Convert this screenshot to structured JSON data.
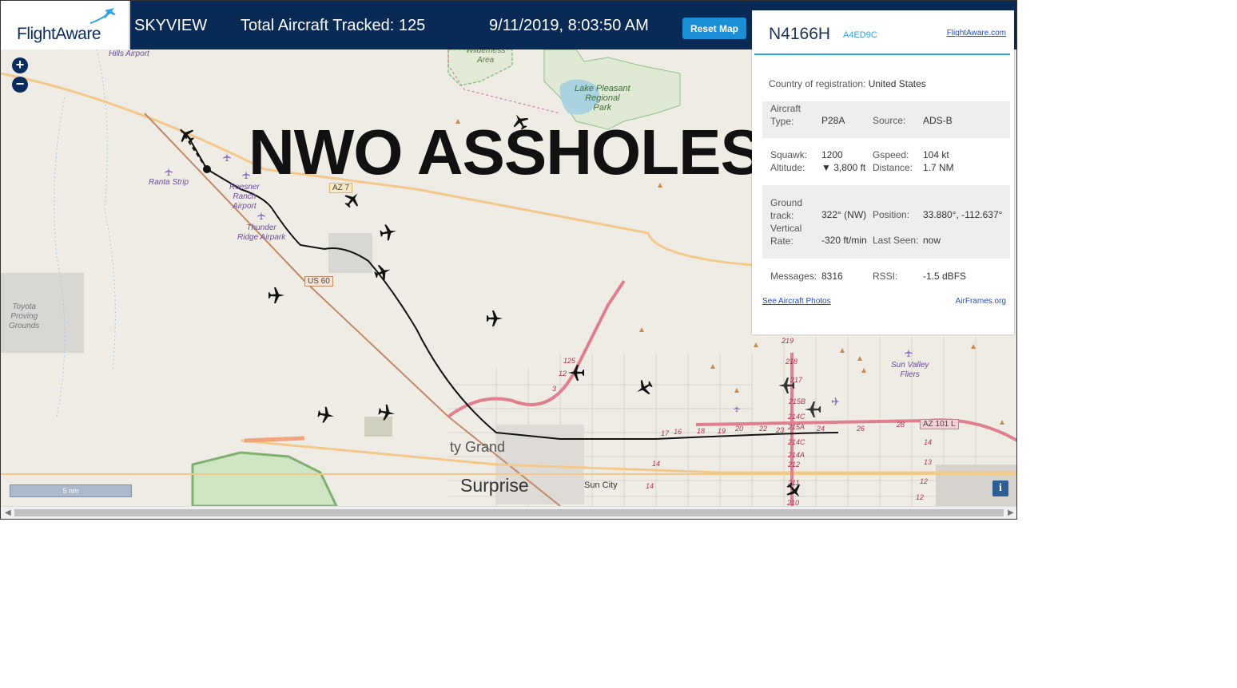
{
  "header": {
    "brand": "FlightAware",
    "view": "SKYVIEW",
    "tracked_label": "Total Aircraft Tracked: 125",
    "datetime": "9/11/2019, 8:03:50 AM",
    "reset_label": "Reset Map"
  },
  "overlay_text": "NWO ASSHOLES",
  "map": {
    "zoom_in": "+",
    "zoom_out": "−",
    "scale_label": "5 nm",
    "info_label": "i",
    "labels": {
      "hills_airport": "Hills Airport",
      "wilderness": "Wilderness\nArea",
      "lake_pleasant": "Lake Pleasant\nRegional\nPark",
      "ranta_strip": "Ranta Strip",
      "roesner": "Roesner\nRanch\nAirport",
      "thunder_ridge": "Thunder\nRidge Airpark",
      "toyota": "Toyota\nProving\nGrounds",
      "sun_valley": "Sun Valley\nFliers",
      "surprise": "Surprise",
      "sun_city": "Sun City",
      "city_grand": "ty Grand",
      "us60": "US 60",
      "az74": "AZ 7",
      "az101": "AZ 101 L"
    },
    "exits": [
      "219",
      "218",
      "217",
      "215B",
      "214C",
      "215A",
      "214C",
      "214A",
      "212",
      "211",
      "210",
      "125",
      "12",
      "3",
      "17",
      "16",
      "18",
      "19",
      "20",
      "22",
      "23",
      "24",
      "26",
      "28",
      "14",
      "13",
      "12",
      "14",
      "12",
      "14"
    ]
  },
  "panel": {
    "callsign": "N4166H",
    "hex": "A4ED9C",
    "link": "FlightAware.com",
    "country_label": "Country of registration:",
    "country_value": "United States",
    "aircraft_type_label": "Aircraft\nType:",
    "aircraft_type_value": "P28A",
    "source_label": "Source:",
    "source_value": "ADS-B",
    "squawk_label": "Squawk:",
    "squawk_value": "1200",
    "altitude_label": "Altitude:",
    "altitude_value": "▼ 3,800 ft",
    "gspeed_label": "Gspeed:",
    "gspeed_value": "104 kt",
    "distance_label": "Distance:",
    "distance_value": "1.7 NM",
    "ground_track_label": "Ground\ntrack:",
    "ground_track_value": "322° (NW)",
    "position_label": "Position:",
    "position_value": "33.880°, -112.637°",
    "vertical_rate_label": "Vertical\nRate:",
    "vertical_rate_value": "-320 ft/min",
    "last_seen_label": "Last Seen:",
    "last_seen_value": "now",
    "messages_label": "Messages:",
    "messages_value": "8316",
    "rssi_label": "RSSI:",
    "rssi_value": "-1.5 dBFS",
    "photos_link": "See Aircraft Photos",
    "airframes_link": "AirFrames.org"
  },
  "colors": {
    "header_bg": "#092a55",
    "accent": "#2ea3e0",
    "button": "#1b8fd6",
    "track": "#111111",
    "map_bg": "#efece6"
  }
}
